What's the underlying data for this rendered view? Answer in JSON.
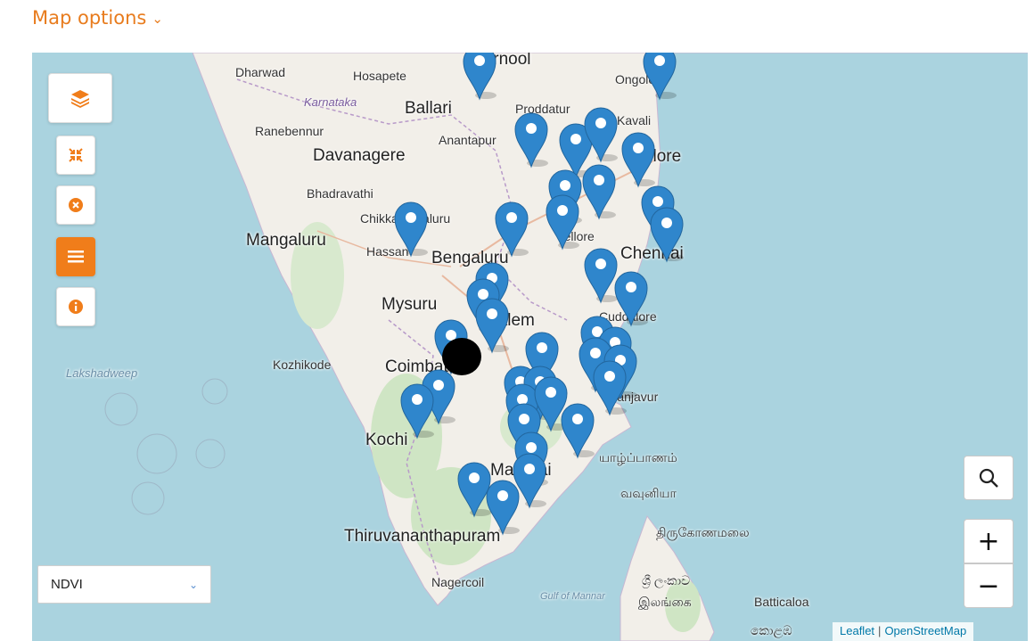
{
  "header": {
    "map_options_label": "Map options"
  },
  "layer_select": {
    "selected": "NDVI"
  },
  "attribution": {
    "leaflet": "Leaflet",
    "separator": "|",
    "osm": "OpenStreetMap"
  },
  "zoom": {
    "in_label": "+",
    "out_label": "−"
  },
  "controls": [
    {
      "name": "layers-button",
      "icon": "layers-icon"
    },
    {
      "name": "collapse-button",
      "icon": "collapse-arrows-icon"
    },
    {
      "name": "clear-button",
      "icon": "close-circle-icon"
    },
    {
      "name": "list-button",
      "icon": "list-icon",
      "active": true
    },
    {
      "name": "info-button",
      "icon": "info-icon"
    }
  ],
  "colors": {
    "accent": "#f07d1a",
    "marker": "#2f86cc",
    "sea": "#aad3df",
    "land": "#f2efe9"
  },
  "place_labels": {
    "dharwad": "Dharwad",
    "hosapete": "Hosapete",
    "kurnool": "Kurnool",
    "ongole": "Ongole",
    "karnataka": "Karnataka",
    "ballari": "Ballari",
    "proddatur": "Proddatur",
    "kavali": "Kavali",
    "ranebennur": "Ranebennur",
    "anantapur": "Anantapur",
    "davanagere": "Davanagere",
    "nellore": "Nellore",
    "bhadravathi": "Bhadravathi",
    "chikkamagaluru": "Chikkamagaluru",
    "mangaluru": "Mangaluru",
    "hassan": "Hassan",
    "bengaluru": "Bengaluru",
    "vellore": "Vellore",
    "chennai": "Chennai",
    "mysuru": "Mysuru",
    "salem": "Salem",
    "cuddalore": "Cuddalore",
    "lakshadweep": "Lakshadweep",
    "kozhikode": "Kozhikode",
    "coimbatore": "Coimbatore",
    "thanjavur": "Thanjavur",
    "kochi": "Kochi",
    "madurai": "Madurai",
    "jaffna": "யாழ்ப்பாணம்",
    "vavuniya": "வவுனியா",
    "thiruvananthapuram": "Thiruvananthapuram",
    "trincomalee": "திருகோணமலை",
    "nagercoil": "Nagercoil",
    "gulf_mannar": "Gulf of Mannar",
    "sri_lanka": "ශ්‍රී ලංකාව",
    "ilankai": "இலங்கை",
    "batticaloa": "Batticaloa",
    "colombo": "කොළඹ"
  }
}
